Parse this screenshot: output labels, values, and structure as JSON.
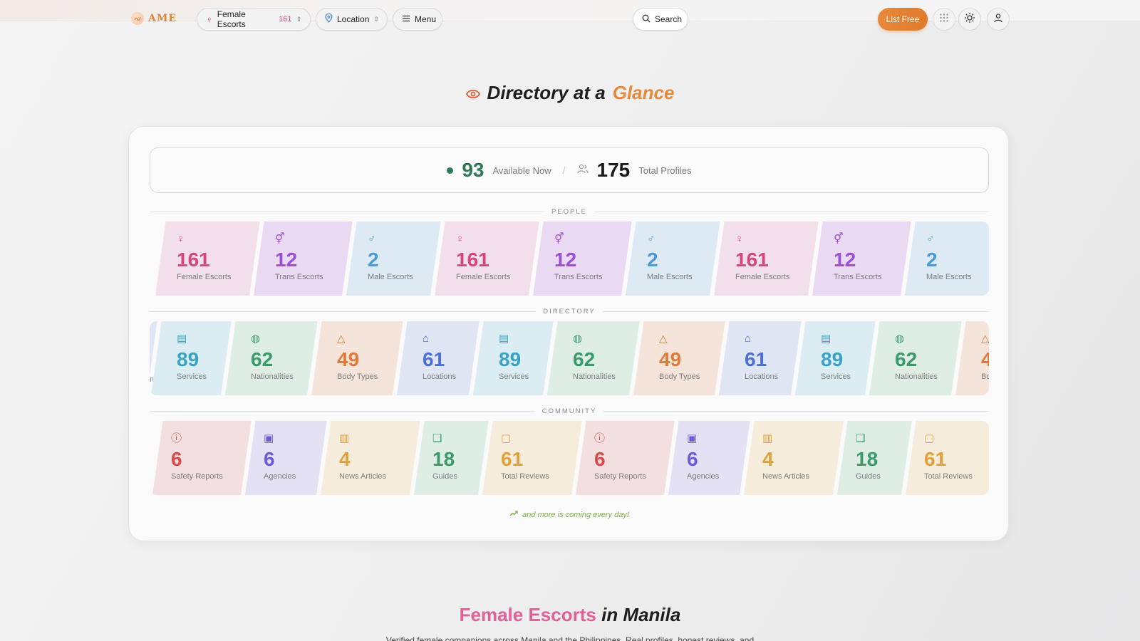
{
  "nav": {
    "logo_text": "AME",
    "category": {
      "label": "Female Escorts",
      "count": "161"
    },
    "location_label": "Location",
    "menu_label": "Menu",
    "search_label": "Search",
    "cta_label": "List Free"
  },
  "colors": {
    "accent": "#e8893a",
    "female": "#d6457f",
    "trans": "#9b4fd6",
    "male": "#4a9bd6",
    "available": "#2f7a56"
  },
  "heading": {
    "prefix": "Directory at a",
    "accent": "Glance"
  },
  "summary": {
    "available_count": "93",
    "available_label": "Available Now",
    "separator": "/",
    "total_count": "175",
    "total_label": "Total Profiles"
  },
  "sections": {
    "people": "PEOPLE",
    "directory": "DIRECTORY",
    "community": "COMMUNITY"
  },
  "people_tiles": [
    {
      "icon": "♀",
      "icon_name": "female-icon",
      "value": "161",
      "label": "Female Escorts",
      "color": "#d6457f",
      "bg": "#f3dfe9"
    },
    {
      "icon": "⚥",
      "icon_name": "trans-icon",
      "value": "12",
      "label": "Trans Escorts",
      "color": "#9b4fd6",
      "bg": "#ead9f3"
    },
    {
      "icon": "♂",
      "icon_name": "male-icon",
      "value": "2",
      "label": "Male Escorts",
      "color": "#4a9bd6",
      "bg": "#dde9f3"
    }
  ],
  "directory_tiles": [
    {
      "icon": "⌂",
      "icon_name": "map-pin-icon",
      "value": "61",
      "label": "Locations",
      "color": "#4a6fd6",
      "bg": "#dfe5f3"
    },
    {
      "icon": "▤",
      "icon_name": "briefcase-icon",
      "value": "89",
      "label": "Services",
      "color": "#3aa3c4",
      "bg": "#dbecf2"
    },
    {
      "icon": "◍",
      "icon_name": "globe-icon",
      "value": "62",
      "label": "Nationalities",
      "color": "#3a9a6a",
      "bg": "#dfeee5"
    },
    {
      "icon": "△",
      "icon_name": "shapes-icon",
      "value": "49",
      "label": "Body Types",
      "color": "#e0793a",
      "bg": "#f5e4d9"
    }
  ],
  "directory_partial_label": "ns",
  "community_tiles": [
    {
      "icon": "ⓘ",
      "icon_name": "alert-circle-icon",
      "value": "6",
      "label": "Safety Reports",
      "color": "#d64a4a",
      "bg": "#f3dfdf"
    },
    {
      "icon": "▣",
      "icon_name": "building-icon",
      "value": "6",
      "label": "Agencies",
      "color": "#6a5ad6",
      "bg": "#e3e1f3"
    },
    {
      "icon": "▥",
      "icon_name": "newspaper-icon",
      "value": "4",
      "label": "News Articles",
      "color": "#e0a03a",
      "bg": "#f5ecdc"
    },
    {
      "icon": "❑",
      "icon_name": "book-open-icon",
      "value": "18",
      "label": "Guides",
      "color": "#3a9a6a",
      "bg": "#dfeee5"
    },
    {
      "icon": "▢",
      "icon_name": "message-square-icon",
      "value": "61",
      "label": "Total Reviews",
      "color": "#e0a03a",
      "bg": "#f5ecdc"
    }
  ],
  "more_text": "and more is coming every day!",
  "bottom": {
    "title_accent": "Female Escorts",
    "title_rest": "in Manila",
    "subtitle": "Verified female companions across Manila and the Philippines. Real profiles, honest reviews, and"
  }
}
